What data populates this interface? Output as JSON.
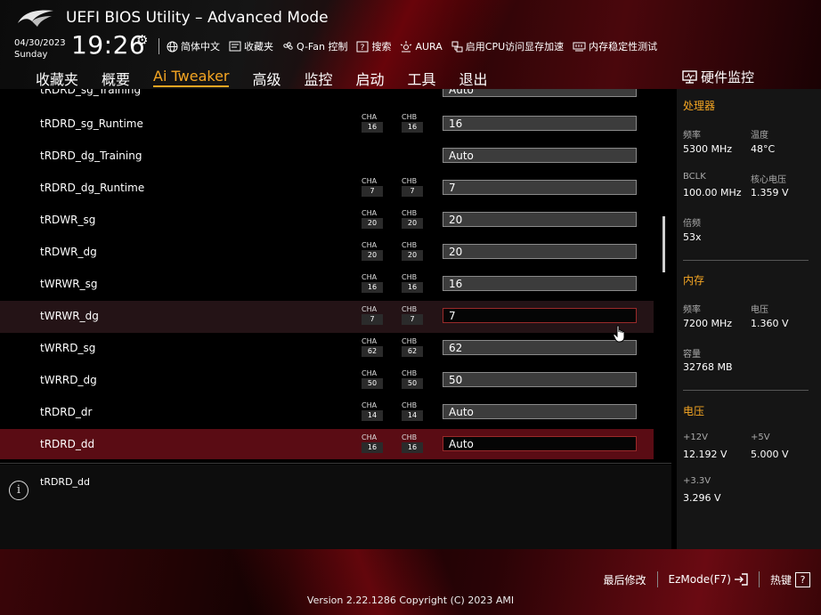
{
  "header": {
    "title": "UEFI BIOS Utility – Advanced Mode",
    "date": "04/30/2023",
    "day": "Sunday",
    "time": "19:26",
    "tools": [
      {
        "label": "简体中文",
        "icon": "globe-icon"
      },
      {
        "label": "收藏夹",
        "icon": "favorites-icon"
      },
      {
        "label": "Q-Fan 控制",
        "icon": "fan-icon"
      },
      {
        "label": "搜索",
        "icon": "search-help-icon"
      },
      {
        "label": "AURA",
        "icon": "aura-icon"
      },
      {
        "label": "启用CPU访问显存加速",
        "icon": "cpu-access-icon"
      },
      {
        "label": "内存稳定性测试",
        "icon": "memory-test-icon"
      }
    ]
  },
  "tabs": [
    "收藏夹",
    "概要",
    "Ai Tweaker",
    "高级",
    "监控",
    "启动",
    "工具",
    "退出"
  ],
  "active_tab": "Ai Tweaker",
  "settings": {
    "partial_row": {
      "label": "tRDRD_sg_Training",
      "value": "Auto"
    },
    "rows": [
      {
        "label": "tRDRD_sg_Runtime",
        "cha": "16",
        "chb": "16",
        "value": "16"
      },
      {
        "label": "tRDRD_dg_Training",
        "cha": "",
        "chb": "",
        "value": "Auto"
      },
      {
        "label": "tRDRD_dg_Runtime",
        "cha": "7",
        "chb": "7",
        "value": "7"
      },
      {
        "label": "tRDWR_sg",
        "cha": "20",
        "chb": "20",
        "value": "20"
      },
      {
        "label": "tRDWR_dg",
        "cha": "20",
        "chb": "20",
        "value": "20"
      },
      {
        "label": "tWRWR_sg",
        "cha": "16",
        "chb": "16",
        "value": "16"
      },
      {
        "label": "tWRWR_dg",
        "cha": "7",
        "chb": "7",
        "value": "7"
      },
      {
        "label": "tWRRD_sg",
        "cha": "62",
        "chb": "62",
        "value": "62"
      },
      {
        "label": "tWRRD_dg",
        "cha": "50",
        "chb": "50",
        "value": "50"
      },
      {
        "label": "tRDRD_dr",
        "cha": "14",
        "chb": "14",
        "value": "Auto"
      },
      {
        "label": "tRDRD_dd",
        "cha": "16",
        "chb": "16",
        "value": "Auto"
      }
    ],
    "cha_label": "CHA",
    "chb_label": "CHB"
  },
  "help": {
    "text": "tRDRD_dd"
  },
  "hw_monitor": {
    "title": "硬件监控",
    "cpu": {
      "section": "处理器",
      "freq_label": "频率",
      "freq": "5300 MHz",
      "temp_label": "温度",
      "temp": "48°C",
      "bclk_label": "BCLK",
      "bclk": "100.00 MHz",
      "vcore_label": "核心电压",
      "vcore": "1.359 V",
      "ratio_label": "倍频",
      "ratio": "53x"
    },
    "memory": {
      "section": "内存",
      "freq_label": "频率",
      "freq": "7200 MHz",
      "volt_label": "电压",
      "volt": "1.360 V",
      "cap_label": "容量",
      "cap": "32768 MB"
    },
    "voltage": {
      "section": "电压",
      "v12_label": "+12V",
      "v12": "12.192 V",
      "v5_label": "+5V",
      "v5": "5.000 V",
      "v33_label": "+3.3V",
      "v33": "3.296 V"
    }
  },
  "footer": {
    "last_modified": "最后修改",
    "ezmode": "EzMode(F7)",
    "hotkeys": "热键",
    "hotkey_cap": "?",
    "version": "Version 2.22.1286 Copyright (C) 2023 AMI"
  },
  "colors": {
    "accent": "#f5a623",
    "highlight_row": "#5a0c14",
    "brand_red": "#b0101c"
  }
}
